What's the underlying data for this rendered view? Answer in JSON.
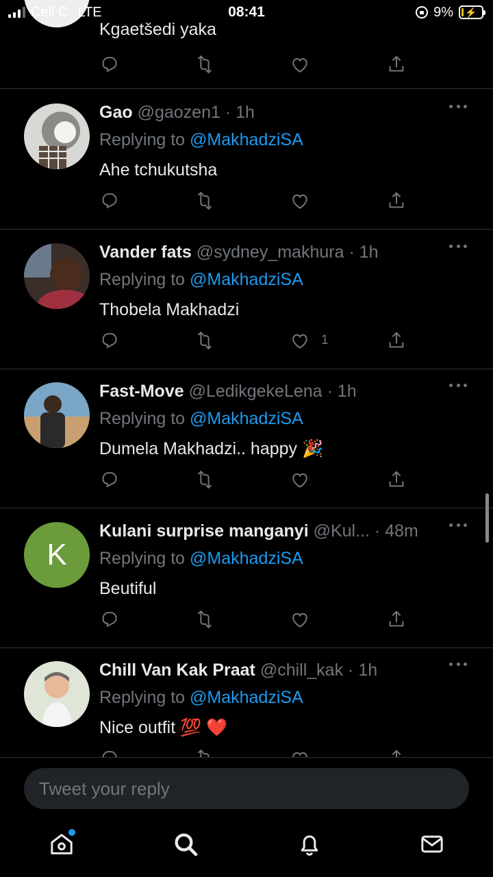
{
  "status_bar": {
    "carrier": "Cell C",
    "network": "LTE",
    "time": "08:41",
    "battery": "9%"
  },
  "colors": {
    "background": "#000000",
    "accent": "#1d9bf0",
    "muted": "#71767b",
    "text": "#e7e9ea"
  },
  "top_tweet": {
    "text": "Kgaetšedi yaka"
  },
  "tweets": [
    {
      "name": "Gao",
      "handle": "@gaozen1",
      "time": "1h",
      "replying_prefix": "Replying to",
      "replying_to": "@MakhadziSA",
      "text": "Ahe tchukutsha",
      "like_count": ""
    },
    {
      "name": "Vander fats",
      "handle": "@sydney_makhura",
      "time": "1h",
      "replying_prefix": "Replying to",
      "replying_to": "@MakhadziSA",
      "text": "Thobela Makhadzi",
      "like_count": "1"
    },
    {
      "name": "Fast-Move",
      "handle": "@LedikgekeLena",
      "time": "1h",
      "replying_prefix": "Replying to",
      "replying_to": "@MakhadziSA",
      "text": "Dumela Makhadzi.. happy 🎉",
      "like_count": ""
    },
    {
      "name": "Kulani surprise manganyi",
      "handle": "@Kul...",
      "time": "48m",
      "avatar_letter": "K",
      "replying_prefix": "Replying to",
      "replying_to": "@MakhadziSA",
      "text": "Beutiful",
      "like_count": ""
    },
    {
      "name": "Chill Van Kak Praat",
      "handle": "@chill_kak",
      "time": "1h",
      "replying_prefix": "Replying to",
      "replying_to": "@MakhadziSA",
      "text": "Nice outfit 💯 ❤️",
      "like_count": ""
    }
  ],
  "reply_box": {
    "placeholder": "Tweet your reply"
  },
  "nav": {
    "items": [
      "home-icon",
      "search-icon",
      "bell-icon",
      "mail-icon"
    ]
  }
}
